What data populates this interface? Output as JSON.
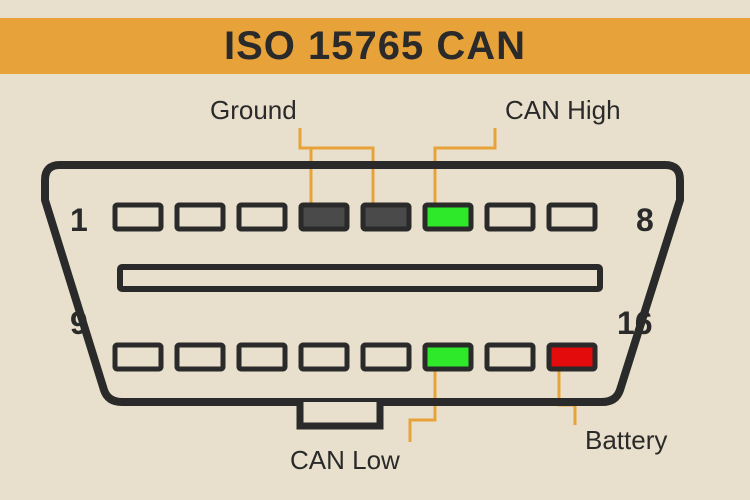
{
  "title": "ISO 15765 CAN",
  "labels": {
    "ground": "Ground",
    "can_high": "CAN High",
    "can_low": "CAN Low",
    "battery": "Battery"
  },
  "pin_numbers": {
    "top_left": "1",
    "top_right": "8",
    "bottom_left": "9",
    "bottom_right": "16"
  },
  "colors": {
    "ground": "#4a4a4a",
    "can": "#2ee82a",
    "battery": "#e30b0b",
    "callout": "#e8a23a",
    "outline": "#2a2a2a",
    "bg": "#e8e0cc"
  },
  "connector": {
    "pins_per_row": 8,
    "top_row": [
      {
        "pin": 1,
        "role": "empty"
      },
      {
        "pin": 2,
        "role": "empty"
      },
      {
        "pin": 3,
        "role": "empty"
      },
      {
        "pin": 4,
        "role": "ground"
      },
      {
        "pin": 5,
        "role": "ground"
      },
      {
        "pin": 6,
        "role": "can_high"
      },
      {
        "pin": 7,
        "role": "empty"
      },
      {
        "pin": 8,
        "role": "empty"
      }
    ],
    "bottom_row": [
      {
        "pin": 9,
        "role": "empty"
      },
      {
        "pin": 10,
        "role": "empty"
      },
      {
        "pin": 11,
        "role": "empty"
      },
      {
        "pin": 12,
        "role": "empty"
      },
      {
        "pin": 13,
        "role": "empty"
      },
      {
        "pin": 14,
        "role": "can_low"
      },
      {
        "pin": 15,
        "role": "empty"
      },
      {
        "pin": 16,
        "role": "battery"
      }
    ]
  }
}
